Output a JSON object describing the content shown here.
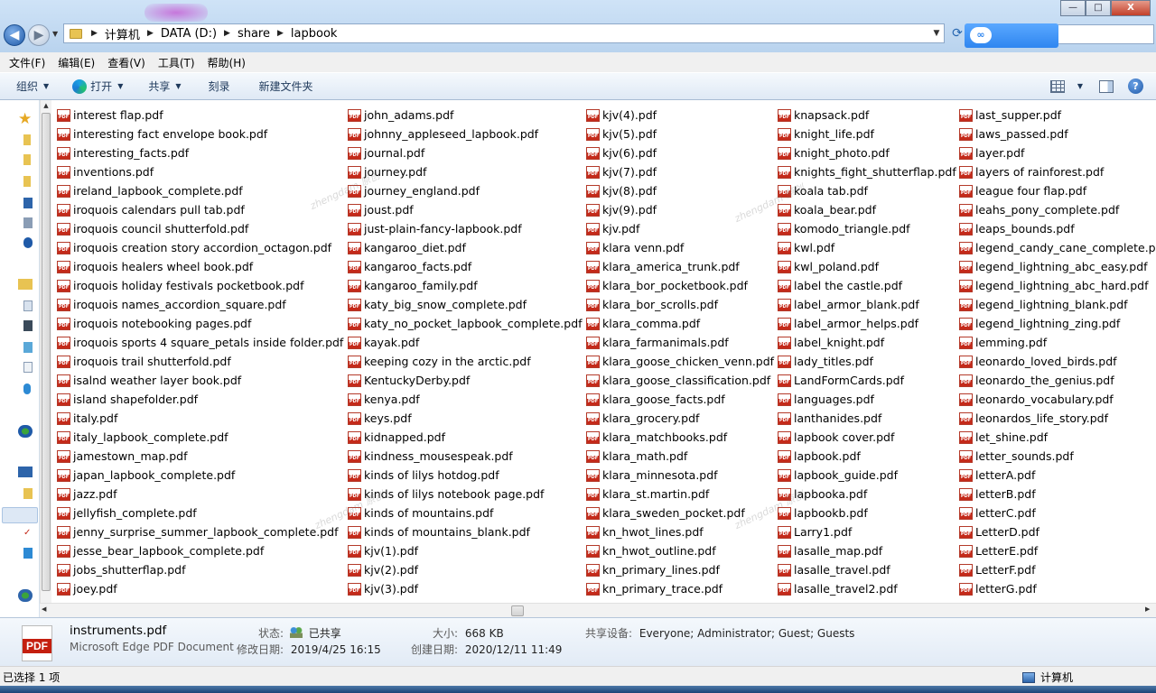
{
  "address": {
    "crumbs": [
      "计算机",
      "DATA (D:)",
      "share",
      "lapbook"
    ]
  },
  "window_buttons": {
    "minimize": "—",
    "maximize": "□",
    "close": "X"
  },
  "menu": [
    "文件(F)",
    "编辑(E)",
    "查看(V)",
    "工具(T)",
    "帮助(H)"
  ],
  "toolbar": {
    "organize": "组织",
    "open": "打开",
    "share": "共享",
    "burn": "刻录",
    "new_folder": "新建文件夹",
    "help": "?"
  },
  "files": {
    "col1": [
      "interest flap.pdf",
      "interesting fact envelope book.pdf",
      "interesting_facts.pdf",
      "inventions.pdf",
      "ireland_lapbook_complete.pdf",
      "iroquois calendars pull tab.pdf",
      "iroquois council shutterfold.pdf",
      "iroquois creation story accordion_octagon.pdf",
      "iroquois healers wheel book.pdf",
      "iroquois holiday festivals pocketbook.pdf",
      "iroquois names_accordion_square.pdf",
      "iroquois notebooking pages.pdf",
      "iroquois sports 4 square_petals inside folder.pdf",
      "iroquois trail shutterfold.pdf",
      "isalnd weather layer book.pdf",
      "island shapefolder.pdf",
      "italy.pdf",
      "italy_lapbook_complete.pdf",
      "jamestown_map.pdf",
      "japan_lapbook_complete.pdf",
      "jazz.pdf",
      "jellyfish_complete.pdf",
      "jenny_surprise_summer_lapbook_complete.pdf",
      "jesse_bear_lapbook_complete.pdf",
      "jobs_shutterflap.pdf",
      "joey.pdf"
    ],
    "col2": [
      "john_adams.pdf",
      "johnny_appleseed_lapbook.pdf",
      "journal.pdf",
      "journey.pdf",
      "journey_england.pdf",
      "joust.pdf",
      "just-plain-fancy-lapbook.pdf",
      "kangaroo_diet.pdf",
      "kangaroo_facts.pdf",
      "kangaroo_family.pdf",
      "katy_big_snow_complete.pdf",
      "katy_no_pocket_lapbook_complete.pdf",
      "kayak.pdf",
      "keeping cozy in the arctic.pdf",
      "KentuckyDerby.pdf",
      "kenya.pdf",
      "keys.pdf",
      "kidnapped.pdf",
      "kindness_mousespeak.pdf",
      "kinds of lilys hotdog.pdf",
      "kinds of lilys notebook page.pdf",
      "kinds of mountains.pdf",
      "kinds of mountains_blank.pdf",
      "kjv(1).pdf",
      "kjv(2).pdf",
      "kjv(3).pdf"
    ],
    "col3": [
      "kjv(4).pdf",
      "kjv(5).pdf",
      "kjv(6).pdf",
      "kjv(7).pdf",
      "kjv(8).pdf",
      "kjv(9).pdf",
      "kjv.pdf",
      "klara venn.pdf",
      "klara_america_trunk.pdf",
      "klara_bor_pocketbook.pdf",
      "klara_bor_scrolls.pdf",
      "klara_comma.pdf",
      "klara_farmanimals.pdf",
      "klara_goose_chicken_venn.pdf",
      "klara_goose_classification.pdf",
      "klara_goose_facts.pdf",
      "klara_grocery.pdf",
      "klara_matchbooks.pdf",
      "klara_math.pdf",
      "klara_minnesota.pdf",
      "klara_st.martin.pdf",
      "klara_sweden_pocket.pdf",
      "kn_hwot_lines.pdf",
      "kn_hwot_outline.pdf",
      "kn_primary_lines.pdf",
      "kn_primary_trace.pdf"
    ],
    "col4": [
      "knapsack.pdf",
      "knight_life.pdf",
      "knight_photo.pdf",
      "knights_fight_shutterflap.pdf",
      "koala tab.pdf",
      "koala_bear.pdf",
      "komodo_triangle.pdf",
      "kwl.pdf",
      "kwl_poland.pdf",
      "label the castle.pdf",
      "label_armor_blank.pdf",
      "label_armor_helps.pdf",
      "label_knight.pdf",
      "lady_titles.pdf",
      "LandFormCards.pdf",
      "languages.pdf",
      "lanthanides.pdf",
      "lapbook cover.pdf",
      "lapbook.pdf",
      "lapbook_guide.pdf",
      "lapbooka.pdf",
      "lapbookb.pdf",
      "Larry1.pdf",
      "lasalle_map.pdf",
      "lasalle_travel.pdf",
      "lasalle_travel2.pdf"
    ],
    "col5": [
      "last_supper.pdf",
      "laws_passed.pdf",
      "layer.pdf",
      "layers of rainforest.pdf",
      "league four flap.pdf",
      "leahs_pony_complete.pdf",
      "leaps_bounds.pdf",
      "legend_candy_cane_complete.pdf",
      "legend_lightning_abc_easy.pdf",
      "legend_lightning_abc_hard.pdf",
      "legend_lightning_blank.pdf",
      "legend_lightning_zing.pdf",
      "lemming.pdf",
      "leonardo_loved_birds.pdf",
      "leonardo_the_genius.pdf",
      "leonardo_vocabulary.pdf",
      "leonardos_life_story.pdf",
      "let_shine.pdf",
      "letter_sounds.pdf",
      "letterA.pdf",
      "letterB.pdf",
      "letterC.pdf",
      "LetterD.pdf",
      "LetterE.pdf",
      "LetterF.pdf",
      "letterG.pdf"
    ]
  },
  "details": {
    "icon_label": "PDF",
    "filename": "instruments.pdf",
    "filetype": "Microsoft Edge PDF Document",
    "status_label": "状态:",
    "status_value": "已共享",
    "modified_label": "修改日期:",
    "modified_value": "2019/4/25 16:15",
    "size_label": "大小:",
    "size_value": "668 KB",
    "created_label": "创建日期:",
    "created_value": "2020/12/11 11:49",
    "shared_label": "共享设备:",
    "shared_value": "Everyone; Administrator; Guest; Guests"
  },
  "statusbar": {
    "selected": "已选择 1 项",
    "location": "计算机"
  },
  "colors": {
    "address_bg": "#cfe3f7",
    "toolbar_text": "#1e395b",
    "pdf_red": "#c42a1a"
  }
}
